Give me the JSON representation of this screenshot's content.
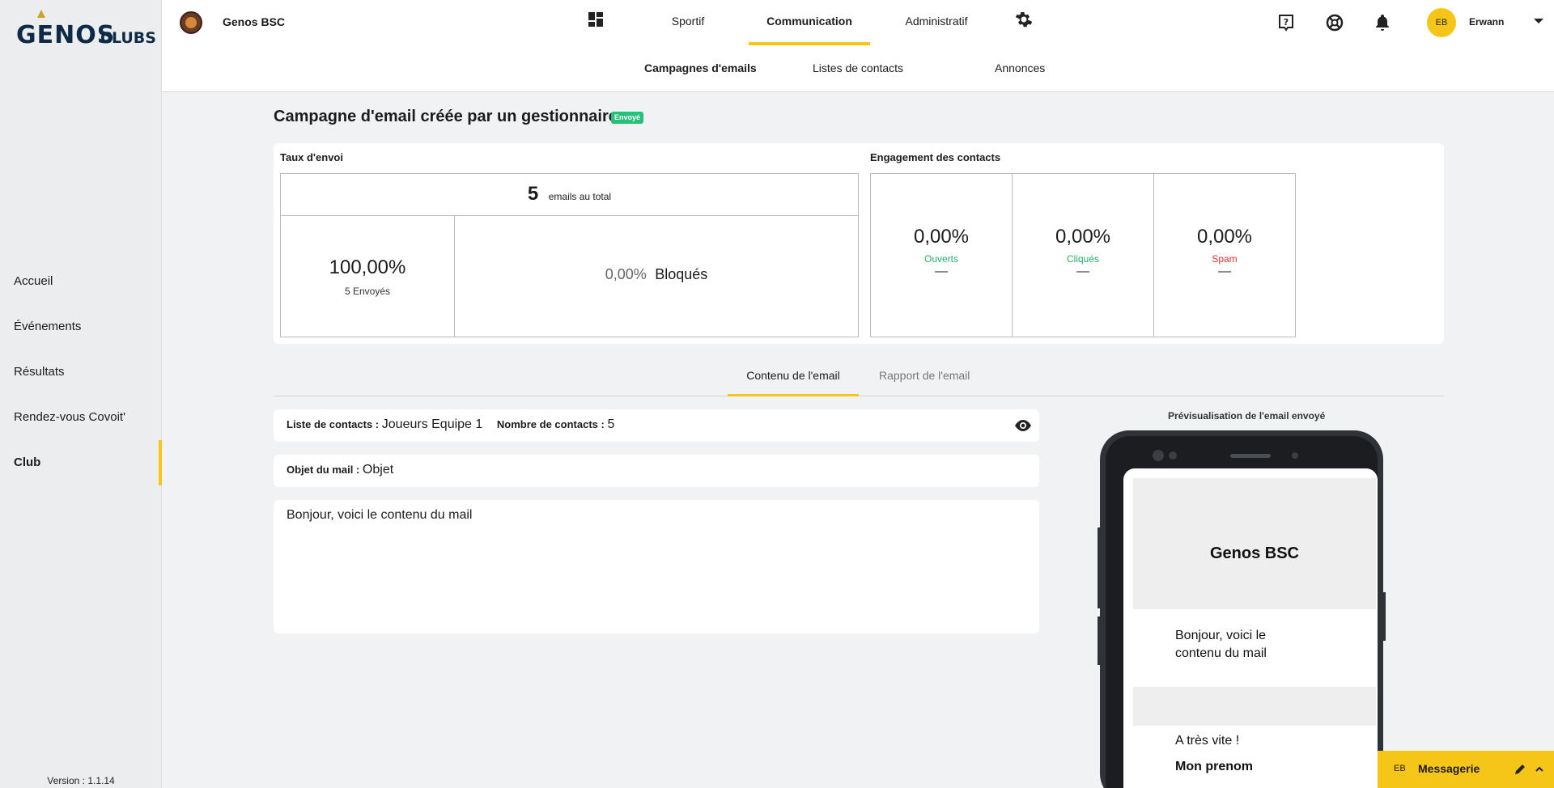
{
  "sidebar": {
    "logo_main": "GENOS",
    "logo_sub": "CLUBS",
    "items": [
      {
        "label": "Accueil"
      },
      {
        "label": "Événements"
      },
      {
        "label": "Résultats"
      },
      {
        "label": "Rendez-vous Covoit'"
      },
      {
        "label": "Club"
      }
    ],
    "active_index": 4,
    "version": "Version : 1.1.14"
  },
  "header": {
    "club_name": "Genos BSC",
    "main_tabs": [
      {
        "label": "Sportif"
      },
      {
        "label": "Communication"
      },
      {
        "label": "Administratif"
      }
    ],
    "active_main_tab": "Communication",
    "sub_tabs": [
      {
        "label": "Campagnes d'emails"
      },
      {
        "label": "Listes de contacts"
      },
      {
        "label": "Annonces"
      }
    ],
    "active_sub_tab": "Campagnes d'emails",
    "user": {
      "initials": "EB",
      "name": "Erwann"
    }
  },
  "campaign": {
    "title": "Campagne d'email créée par un gestionnaire",
    "status": "Envoyé",
    "send_rate": {
      "label": "Taux d'envoi",
      "total_value": "5",
      "total_label": "emails au total",
      "sent_pct": "100,00%",
      "sent_label": "5 Envoyés",
      "blocked_pct": "0,00%",
      "blocked_label": "Bloqués"
    },
    "engagement": {
      "label": "Engagement des contacts",
      "items": [
        {
          "pct": "0,00%",
          "label": "Ouverts",
          "dash": "—",
          "color": "#27b06a"
        },
        {
          "pct": "0,00%",
          "label": "Cliqués",
          "dash": "—",
          "color": "#27b06a"
        },
        {
          "pct": "0,00%",
          "label": "Spam",
          "dash": "—",
          "color": "#e0312f"
        }
      ]
    }
  },
  "content_tabs": [
    {
      "label": "Contenu de l'email"
    },
    {
      "label": "Rapport de l'email"
    }
  ],
  "active_content_tab": "Contenu de l'email",
  "email": {
    "contact_list_label": "Liste de contacts :",
    "contact_list_value": "Joueurs Equipe 1",
    "contact_count_label": "Nombre de contacts :",
    "contact_count_value": "5",
    "subject_label": "Objet du mail :",
    "subject_value": "Objet",
    "body": "Bonjour, voici le contenu du mail"
  },
  "preview": {
    "title": "Prévisualisation de l'email envoyé",
    "club_name": "Genos BSC",
    "body": "Bonjour, voici le contenu du mail",
    "closing": "A très vite !",
    "signature": "Mon prenom"
  },
  "messagerie": {
    "initials": "EB",
    "label": "Messagerie"
  },
  "colors": {
    "accent": "#f5c518",
    "success": "#27c07a",
    "danger": "#e0312f"
  }
}
